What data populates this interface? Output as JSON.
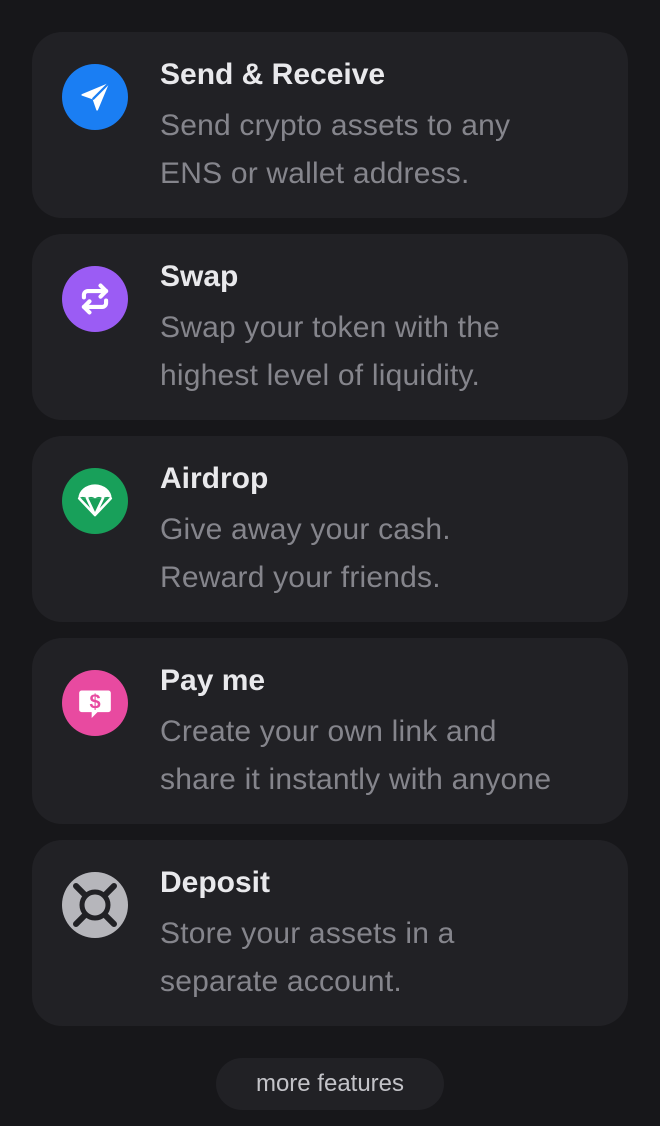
{
  "features": [
    {
      "title": "Send & Receive",
      "desc_line1": "Send crypto assets to any",
      "desc_line2": "ENS or wallet address.",
      "icon": "paper-plane-icon",
      "icon_bg": "#1a7ef3"
    },
    {
      "title": "Swap",
      "desc_line1": "Swap your token with the",
      "desc_line2": "highest level of liquidity.",
      "icon": "swap-arrows-icon",
      "icon_bg": "#9b5cf4"
    },
    {
      "title": "Airdrop",
      "desc_line1": "Give away your cash.",
      "desc_line2": "Reward your friends.",
      "icon": "parachute-icon",
      "icon_bg": "#18a05a"
    },
    {
      "title": "Pay me",
      "desc_line1": "Create your own link and",
      "desc_line2": "share it instantly with anyone",
      "icon": "dollar-chat-icon",
      "icon_bg": "#e84aa0"
    },
    {
      "title": "Deposit",
      "desc_line1": "Store your assets in a",
      "desc_line2": "separate account.",
      "icon": "lifebuoy-icon",
      "icon_bg": "#b6b6bb"
    }
  ],
  "more_button": {
    "label": "more features"
  }
}
